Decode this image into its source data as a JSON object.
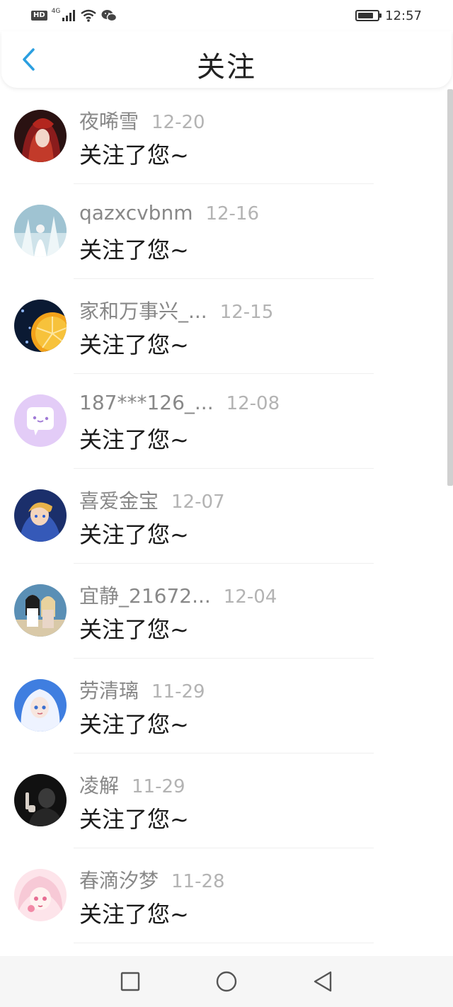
{
  "status_bar": {
    "hd": "HD",
    "network": "4G",
    "time": "12:57",
    "battery_level": 0.8
  },
  "header": {
    "title": "关注",
    "back_icon": "chevron-left-icon",
    "accent_color": "#2b9fe0"
  },
  "items": [
    {
      "name": "夜唏雪",
      "date": "12-20",
      "message": "关注了您~",
      "avatar_icon": "avatar-image"
    },
    {
      "name": "qazxcvbnm",
      "date": "12-16",
      "message": "关注了您~",
      "avatar_icon": "avatar-image"
    },
    {
      "name": "家和万事兴_...",
      "date": "12-15",
      "message": "关注了您~",
      "avatar_icon": "avatar-image"
    },
    {
      "name": "187***126_...",
      "date": "12-08",
      "message": "关注了您~",
      "avatar_icon": "default-chat-avatar-icon"
    },
    {
      "name": "喜爱金宝",
      "date": "12-07",
      "message": "关注了您~",
      "avatar_icon": "avatar-image"
    },
    {
      "name": "宜静_21672...",
      "date": "12-04",
      "message": "关注了您~",
      "avatar_icon": "avatar-image"
    },
    {
      "name": "劳清璃",
      "date": "11-29",
      "message": "关注了您~",
      "avatar_icon": "avatar-image"
    },
    {
      "name": "凌解",
      "date": "11-29",
      "message": "关注了您~",
      "avatar_icon": "avatar-image"
    },
    {
      "name": "春滴汐梦",
      "date": "11-28",
      "message": "关注了您~",
      "avatar_icon": "avatar-image"
    }
  ],
  "nav_bar": {
    "recents_icon": "square-icon",
    "home_icon": "circle-icon",
    "back_icon": "triangle-back-icon"
  }
}
